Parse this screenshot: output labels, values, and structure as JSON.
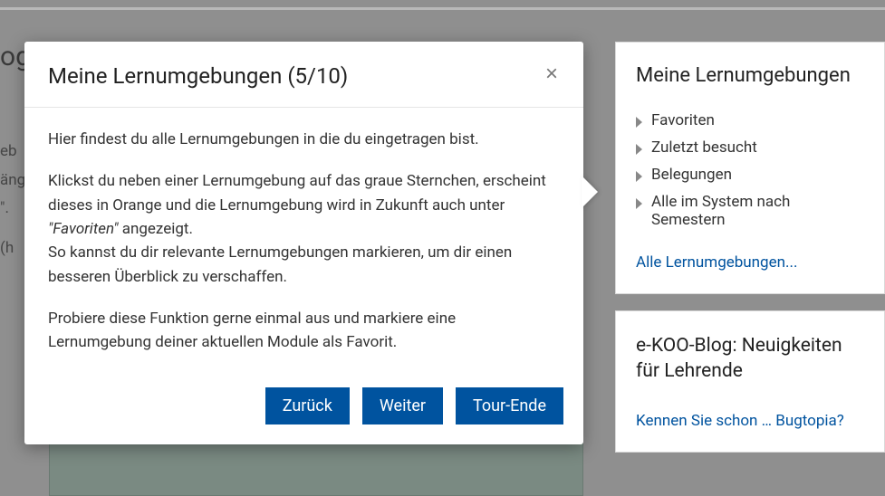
{
  "background": {
    "title_fragment": "og",
    "line1": "eb",
    "line2": "äng",
    "line3": "\".",
    "line4": "(h"
  },
  "modal": {
    "title": "Meine Lernumgebungen (5/10)",
    "p1": "Hier findest du alle Lernumgebungen in die du eingetragen bist.",
    "p2a": "Klickst du neben einer Lernumgebung auf das graue Sternchen, erscheint dieses in Orange und die Lernumgebung wird in Zukunft auch unter ",
    "p2_em": "\"Favoriten\"",
    "p2b": " angezeigt.",
    "p2c": "So kannst du dir relevante Lernumgebungen markieren, um dir einen besseren Überblick zu verschaffen.",
    "p3": "Probiere diese Funktion gerne einmal aus und markiere eine Lernumgebung deiner aktuellen Module als Favorit.",
    "buttons": {
      "back": "Zurück",
      "next": "Weiter",
      "end": "Tour-Ende"
    }
  },
  "sidebar": {
    "panel1": {
      "title": "Meine Lernumgebungen",
      "items": [
        "Favoriten",
        "Zuletzt besucht",
        "Belegungen",
        "Alle im System nach Semestern"
      ],
      "all_link": "Alle Lernumgebungen..."
    },
    "panel2": {
      "title": "e-KOO-Blog: Neuigkeiten für Lehrende",
      "link": "Kennen Sie schon … Bugtopia?"
    }
  }
}
